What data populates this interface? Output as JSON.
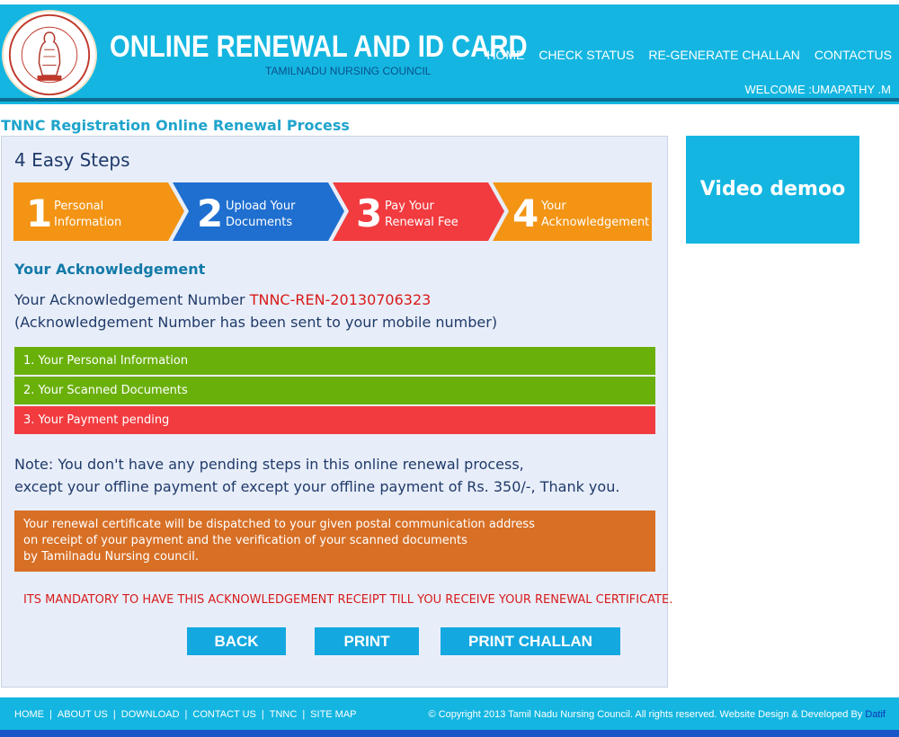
{
  "header": {
    "logo_text": "THE TAMILNADU NURSES AND MIDWIVES COUNCIL",
    "title": "ONLINE RENEWAL AND ID CARD",
    "subtitle": "TAMILNADU NURSING COUNCIL",
    "nav": [
      "HOME",
      "CHECK STATUS",
      "RE-GENERATE CHALLAN",
      "CONTACTUS"
    ],
    "welcome": "WELCOME :UMAPATHY .M"
  },
  "page": {
    "heading": "TNNC Registration Online Renewal Process"
  },
  "steps": {
    "title": "4 Easy Steps",
    "items": [
      {
        "number": "1",
        "line1": "Personal",
        "line2": "Information",
        "color": "#f39414"
      },
      {
        "number": "2",
        "line1": "Upload Your",
        "line2": "Documents",
        "color": "#1f6fd0"
      },
      {
        "number": "3",
        "line1": "Pay Your",
        "line2": "Renewal Fee",
        "color": "#f23b3f"
      },
      {
        "number": "4",
        "line1": "Your",
        "line2": "Acknowledgement",
        "color": "#f39414"
      }
    ]
  },
  "acknowledgement": {
    "title": "Your Acknowledgement",
    "number_label": "Your  Acknowledgement Number ",
    "number": "TNNC-REN-20130706323",
    "sent_note": "(Acknowledgement Number has been sent to your mobile number)"
  },
  "status_rows": [
    {
      "text": "1. Your Personal Information",
      "color": "#6ab00b"
    },
    {
      "text": "2. Your Scanned Documents",
      "color": "#6ab00b"
    },
    {
      "text": "3. Your Payment pending",
      "color": "#f23b3f"
    }
  ],
  "note": {
    "line1": "Note: You don't have any pending steps in this online renewal process,",
    "line2": " except your offline payment of except your offline payment of Rs. 350/-, Thank you."
  },
  "dispatch": {
    "line1": "Your renewal certificate will be dispatched to your given postal communication address",
    "line2": "on receipt of your payment and the verification of your scanned documents",
    "line3": "by Tamilnadu Nursing council."
  },
  "mandatory": "ITS MANDATORY TO HAVE THIS ACKNOWLEDGEMENT RECEIPT TILL YOU RECEIVE YOUR RENEWAL CERTIFICATE.",
  "buttons": {
    "back": "BACK",
    "print": "PRINT",
    "print_challan": "PRINT CHALLAN"
  },
  "video": {
    "label": "Video demoo"
  },
  "footer": {
    "links": [
      "HOME",
      "ABOUT US",
      "DOWNLOAD",
      "CONTACT US",
      "TNNC",
      "SITE MAP"
    ],
    "copyright": "© Copyright 2013 Tamil Nadu Nursing Council. All rights reserved. Website Design & Developed By ",
    "developer": "Datif"
  },
  "colors": {
    "header_bg": "#14b6e1",
    "accent_title": "#1fa4cc",
    "ack_number": "#d81b1b",
    "dispatch_bg": "#d76f25"
  }
}
